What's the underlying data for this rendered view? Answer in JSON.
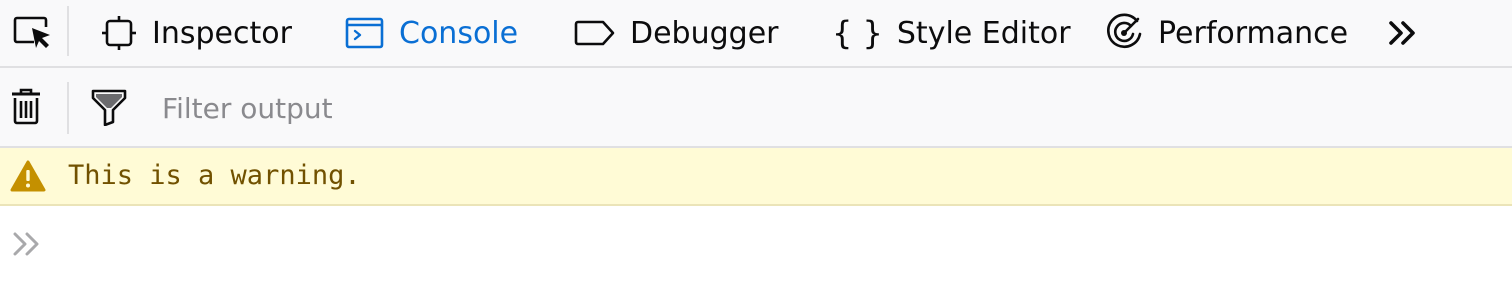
{
  "toolbox": {
    "picker_icon": "element-picker-icon",
    "tabs": [
      {
        "label": "Inspector",
        "icon": "inspector-icon",
        "selected": false
      },
      {
        "label": "Console",
        "icon": "console-icon",
        "selected": true
      },
      {
        "label": "Debugger",
        "icon": "debugger-icon",
        "selected": false
      },
      {
        "label": "Style Editor",
        "icon": "style-editor-icon",
        "selected": false
      },
      {
        "label": "Performance",
        "icon": "performance-icon",
        "selected": false
      }
    ],
    "overflow_icon": "chevron-double-right-icon"
  },
  "console_toolbar": {
    "clear_icon": "trash-icon",
    "filter_icon": "funnel-icon",
    "filter_placeholder": "Filter output",
    "filter_value": ""
  },
  "messages": [
    {
      "level": "warning",
      "icon": "warning-icon",
      "text": "This is a warning."
    }
  ],
  "prompt": {
    "icon": "chevron-double-right-icon"
  },
  "colors": {
    "selected_tab": "#0a6fd4",
    "toolbar_background": "#f9f9fa",
    "warning_background": "#fffbd6",
    "warning_text": "#715100",
    "warning_icon": "#c49000",
    "prompt_icon": "#a9a9ab"
  }
}
